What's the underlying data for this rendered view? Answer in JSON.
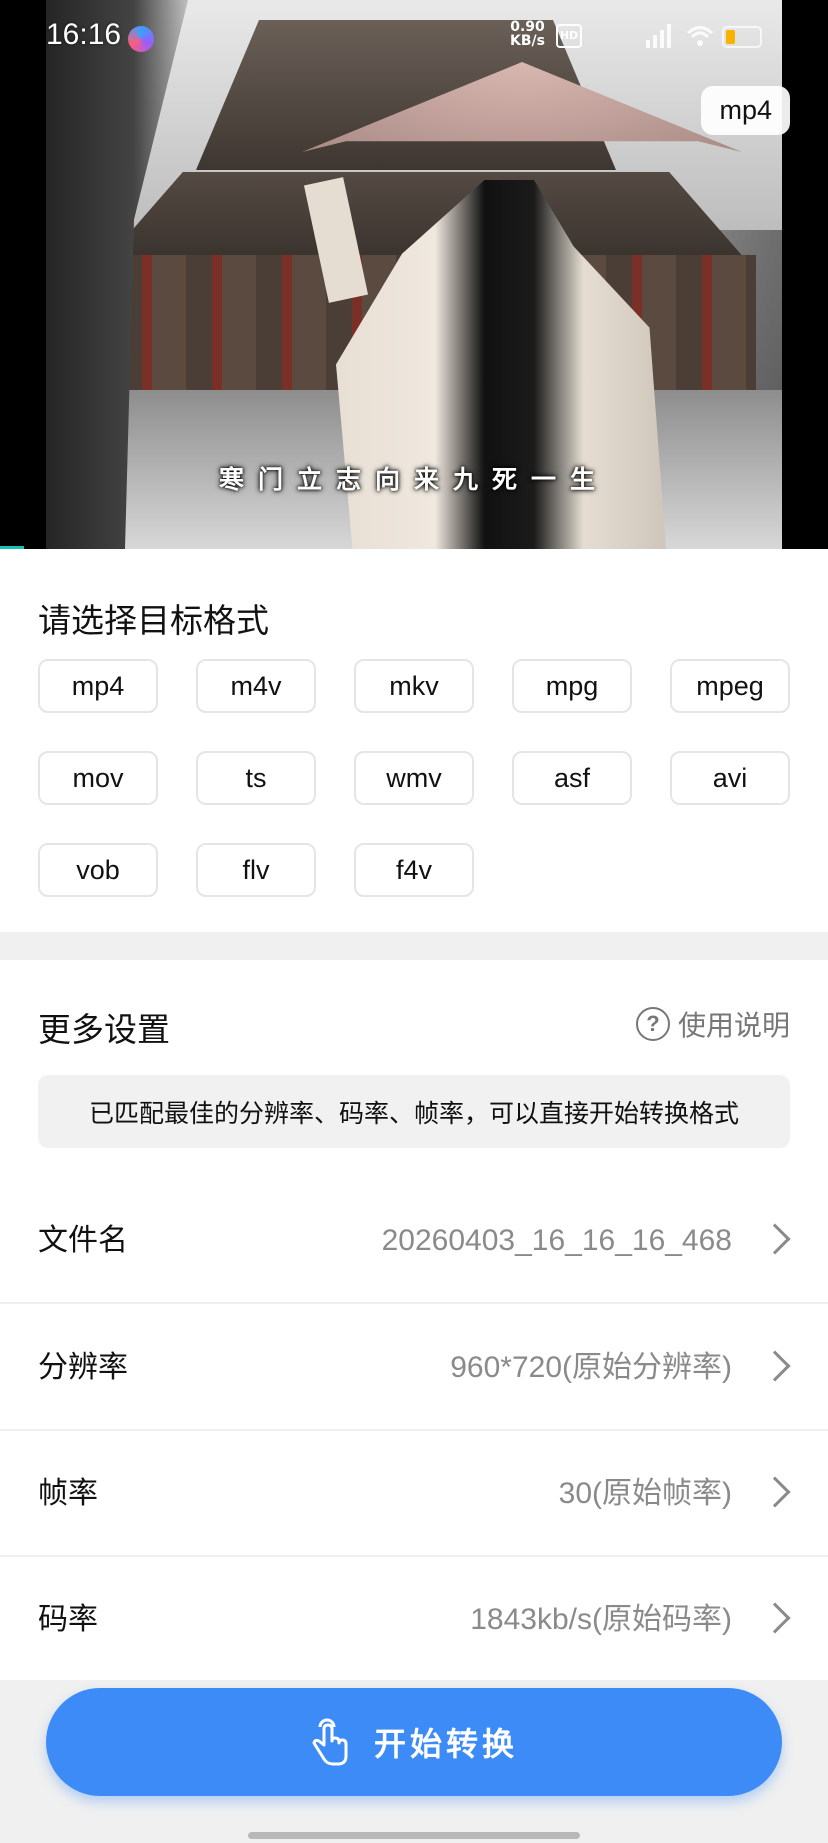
{
  "status_bar": {
    "time": "16:16",
    "net_speed_value": "0.90",
    "net_speed_unit": "KB/s",
    "hd_badge": "HD"
  },
  "video": {
    "format_tag": "mp4",
    "subtitle": "寒门立志向来九死一生"
  },
  "format_section": {
    "title": "请选择目标格式",
    "formats": [
      "mp4",
      "m4v",
      "mkv",
      "mpg",
      "mpeg",
      "mov",
      "ts",
      "wmv",
      "asf",
      "avi",
      "vob",
      "flv",
      "f4v"
    ]
  },
  "more_settings": {
    "title": "更多设置",
    "help_label": "使用说明",
    "help_icon": "question-circle-icon",
    "hint": "已匹配最佳的分辨率、码率、帧率，可以直接开始转换格式",
    "rows": [
      {
        "label": "文件名",
        "value": "20260403_16_16_16_468"
      },
      {
        "label": "分辨率",
        "value": "960*720(原始分辨率)"
      },
      {
        "label": "帧率",
        "value": "30(原始帧率)"
      },
      {
        "label": "码率",
        "value": "1843kb/s(原始码率)"
      }
    ]
  },
  "action": {
    "start_label": "开始转换",
    "icon": "tap-hand-icon"
  },
  "colors": {
    "accent": "#3d8bf7",
    "teal_progress": "#16c2b6",
    "battery": "#f6b400"
  }
}
